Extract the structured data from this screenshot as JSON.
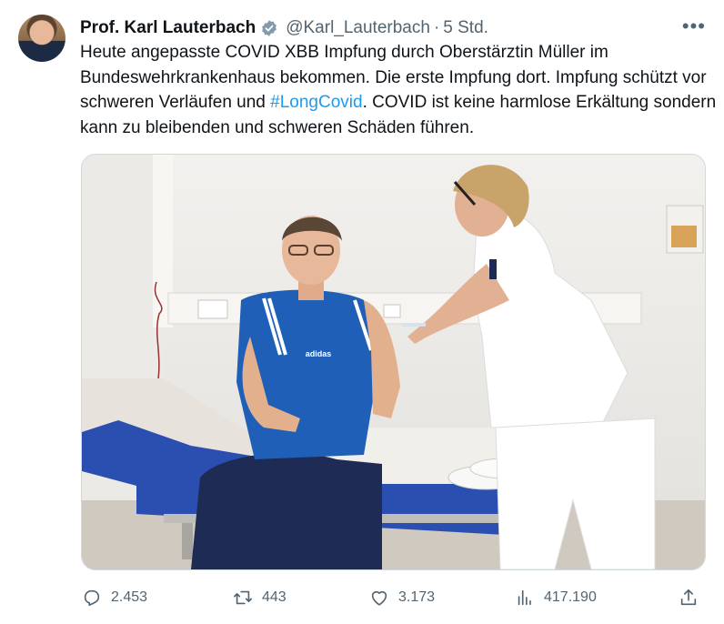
{
  "tweet": {
    "author_name": "Prof. Karl Lauterbach",
    "handle": "@Karl_Lauterbach",
    "separator": "·",
    "time": "5 Std.",
    "text_before": "Heute angepasste COVID XBB Impfung durch Oberstärztin Müller im Bundeswehrkrankenhaus bekommen. Die erste Impfung dort. Impfung schützt vor schweren Verläufen und ",
    "hashtag": "#LongCovid",
    "text_after": ". COVID ist keine harmlose Erkältung sondern kann zu bleibenden und schweren Schäden führen.",
    "shirt_logo_text": "adidas"
  },
  "metrics": {
    "replies": "2.453",
    "retweets": "443",
    "likes": "3.173",
    "views": "417.190"
  },
  "icons": {
    "more": "more-icon",
    "verified": "verified-badge-icon",
    "reply": "reply-icon",
    "retweet": "retweet-icon",
    "like": "like-icon",
    "views": "views-icon",
    "share": "share-icon"
  },
  "colors": {
    "text": "#0f1419",
    "secondary": "#536471",
    "link": "#1d9bf0",
    "border": "#cfd9de"
  }
}
